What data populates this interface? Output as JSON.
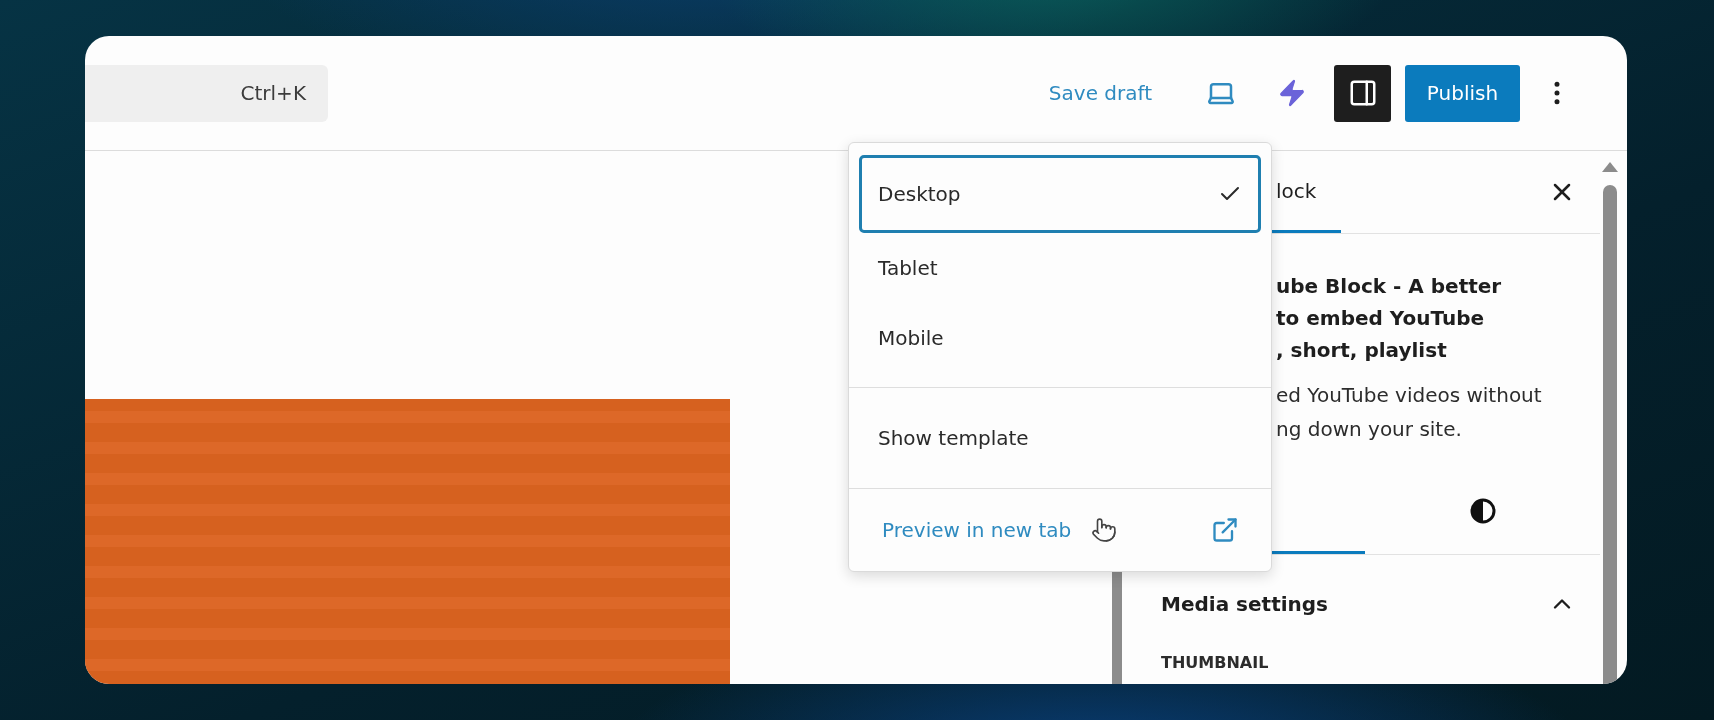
{
  "toolbar": {
    "search": {
      "shortcut": "Ctrl+K"
    },
    "save_draft": "Save draft",
    "sidebar_toggle": {
      "on": true
    },
    "publish": "Publish"
  },
  "preview_menu": {
    "devices": [
      {
        "label": "Desktop",
        "selected": true
      },
      {
        "label": "Tablet",
        "selected": false
      },
      {
        "label": "Mobile",
        "selected": false
      }
    ],
    "show_template": "Show template",
    "preview_link": "Preview in new tab"
  },
  "sidebar": {
    "tab": "lock",
    "title_lines": [
      "ube Block - A better",
      "to embed YouTube",
      ", short, playlist"
    ],
    "description_lines": [
      "ed YouTube videos without",
      "ng down your site."
    ],
    "style_tabs": [
      {
        "selected": true
      },
      {
        "selected": false
      }
    ],
    "panel": {
      "title": "Media settings",
      "expanded": true,
      "field_label": "THUMBNAIL"
    }
  }
}
